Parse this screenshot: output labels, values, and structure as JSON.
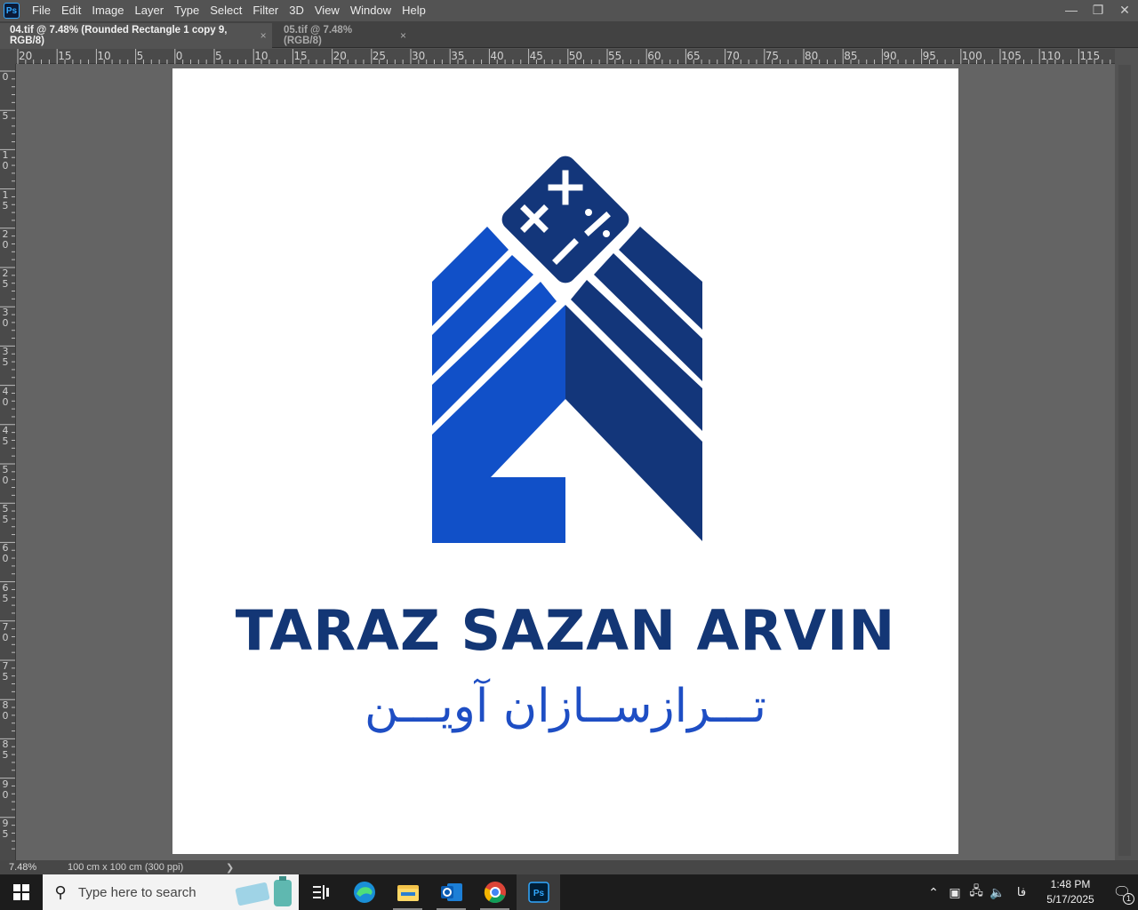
{
  "app": {
    "logo_text": "Ps"
  },
  "menu": [
    "File",
    "Edit",
    "Image",
    "Layer",
    "Type",
    "Select",
    "Filter",
    "3D",
    "View",
    "Window",
    "Help"
  ],
  "window_controls": {
    "minimize": "—",
    "restore": "❐",
    "close": "✕"
  },
  "tabs": [
    {
      "label": "04.tif @ 7.48% (Rounded Rectangle 1 copy 9, RGB/8)",
      "close": "×",
      "active": true
    },
    {
      "label": "05.tif @ 7.48% (RGB/8)",
      "close": "×",
      "active": false
    }
  ],
  "ruler_h_labels": [
    "20",
    "15",
    "10",
    "5",
    "0",
    "5",
    "10",
    "15",
    "20",
    "25",
    "30",
    "35",
    "40",
    "45",
    "50",
    "55",
    "60",
    "65",
    "70",
    "75",
    "80",
    "85",
    "90",
    "95",
    "100",
    "105",
    "110",
    "115"
  ],
  "ruler_v_labels": [
    "0",
    "5",
    "10",
    "15",
    "20",
    "25",
    "30",
    "35",
    "40",
    "45",
    "50",
    "55",
    "60",
    "65",
    "70",
    "75",
    "80",
    "85",
    "90",
    "95"
  ],
  "document": {
    "brand_en": "TARAZ SAZAN ARVIN",
    "brand_fa": "تـــرازســازان آویـــن",
    "colors": {
      "light_blue": "#1150c8",
      "dark_blue": "#13367a",
      "text_navy": "#133675",
      "text_blue": "#1e4ec4"
    }
  },
  "status": {
    "zoom": "7.48%",
    "doc_size": "100 cm x 100 cm (300 ppi)",
    "arrow": "❯"
  },
  "taskbar": {
    "search_placeholder": "Type here to search",
    "lang": "فا",
    "time": "1:48 PM",
    "date": "5/17/2025",
    "notification_count": "1"
  }
}
